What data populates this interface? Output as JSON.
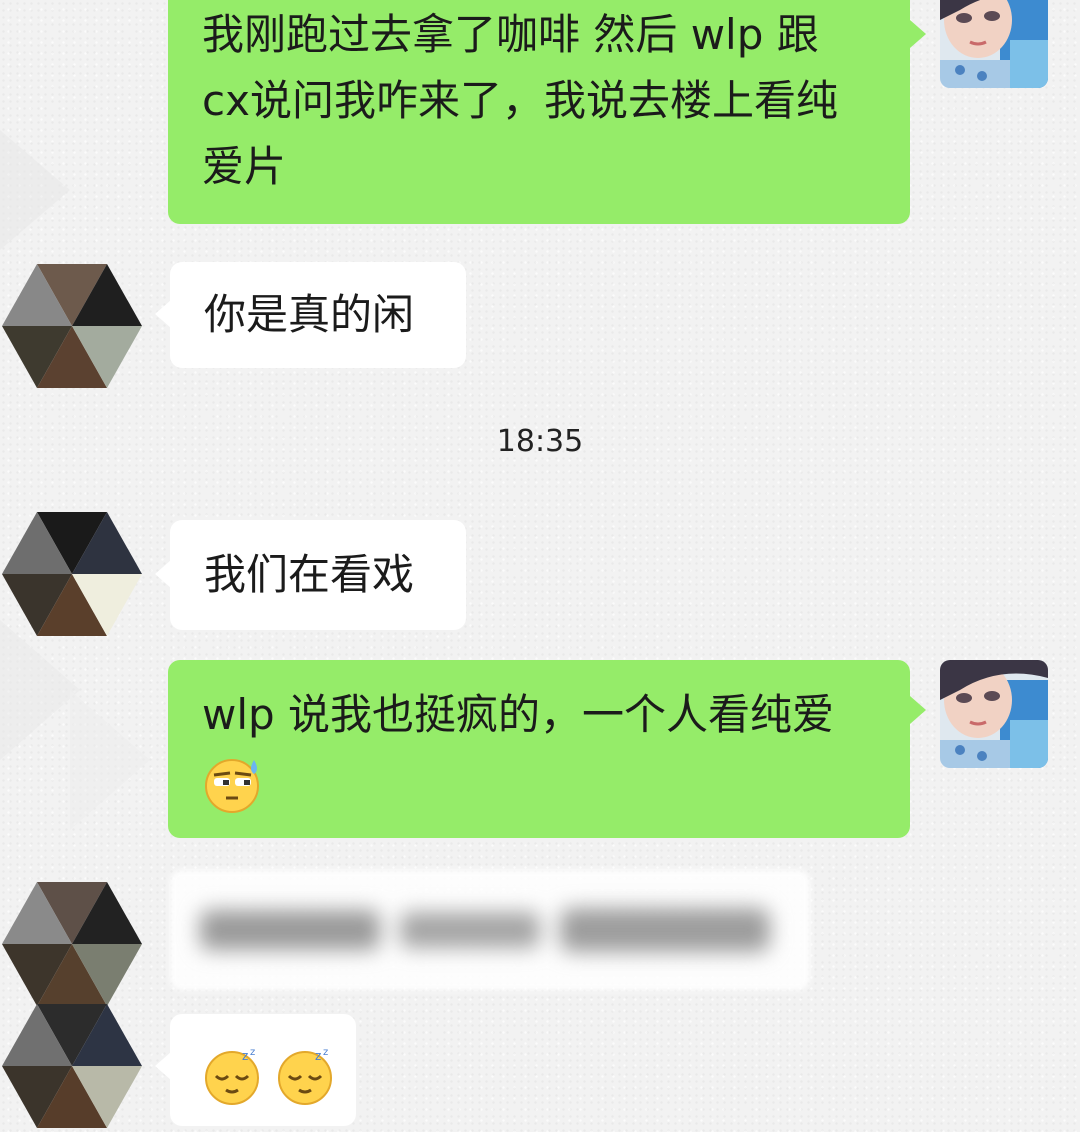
{
  "messages": [
    {
      "side": "right",
      "lines": [
        "我刚跑过去拿了咖啡 然后 wlp 跟",
        "cx说问我咋来了，我说去楼上看纯",
        "爱片"
      ]
    },
    {
      "side": "left",
      "text": "你是真的闲"
    },
    {
      "side": "left",
      "text": "我们在看戏"
    },
    {
      "side": "right",
      "text": "wlp 说我也挺疯的，一个人看纯爱",
      "emoji": "sweat-eye-roll-emoji"
    },
    {
      "side": "left",
      "text": "",
      "blurred": true
    },
    {
      "side": "left",
      "emojis": [
        "sleeping-face-emoji",
        "sleeping-face-emoji"
      ]
    }
  ],
  "timestamp": "18:35",
  "colors": {
    "sent_bubble": "#95ec69",
    "received_bubble": "#ffffff",
    "background": "#f2f2f2"
  }
}
